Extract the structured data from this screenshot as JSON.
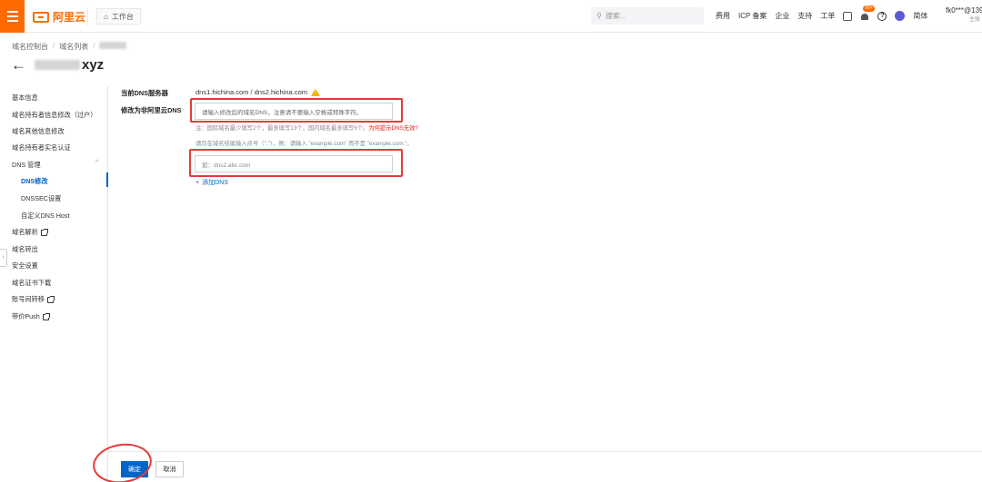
{
  "topbar": {
    "logo_text": "阿里云",
    "workbench": "工作台",
    "search_placeholder": "搜索...",
    "nav": [
      "费用",
      "ICP 备案",
      "企业",
      "支持",
      "工单"
    ],
    "badge": "99+",
    "lang": "简体",
    "account_name": "fk0***@139.c",
    "account_sub": "主账"
  },
  "breadcrumb": {
    "items": [
      "域名控制台",
      "域名列表"
    ]
  },
  "page": {
    "title_suffix": "xyz"
  },
  "sidebar": {
    "items": [
      {
        "label": "基本信息"
      },
      {
        "label": "域名持有者信息修改（过户）"
      },
      {
        "label": "域名其他信息修改"
      },
      {
        "label": "域名持有者实名认证"
      },
      {
        "label": "DNS 管理"
      },
      {
        "label": "DNS修改"
      },
      {
        "label": "DNSSEC设置"
      },
      {
        "label": "自定义DNS Host"
      },
      {
        "label": "域名解析"
      },
      {
        "label": "域名转出"
      },
      {
        "label": "安全设置"
      },
      {
        "label": "域名证书下载"
      },
      {
        "label": "账号间转移"
      },
      {
        "label": "带价Push"
      }
    ]
  },
  "form": {
    "current_dns_label": "当前DNS服务器",
    "current_dns_value": "dns1.hichina.com / dns2.hichina.com",
    "modify_label": "修改为非阿里云DNS",
    "dns1_placeholder": "请输入修改后的域名DNS，注意请不要输入空格或特殊字符。",
    "hint1_prefix": "注：国际域名最少填写2个，最多填写13个，国内域名最多填写6个。",
    "hint1_link": "为何提示DNS无效?",
    "hint2": "请勿在域名结尾输入点号（\".\"），例：请输入 \"example.com\" 而不是 \"example.com.\"。",
    "dns2_placeholder": "如：dns2.abc.com",
    "add_dns": "添加DNS"
  },
  "footer": {
    "confirm": "确定",
    "cancel": "取消"
  },
  "colors": {
    "brand_orange": "#ff6a00",
    "primary_blue": "#0064c8",
    "annotation_red": "#e33b3b"
  }
}
